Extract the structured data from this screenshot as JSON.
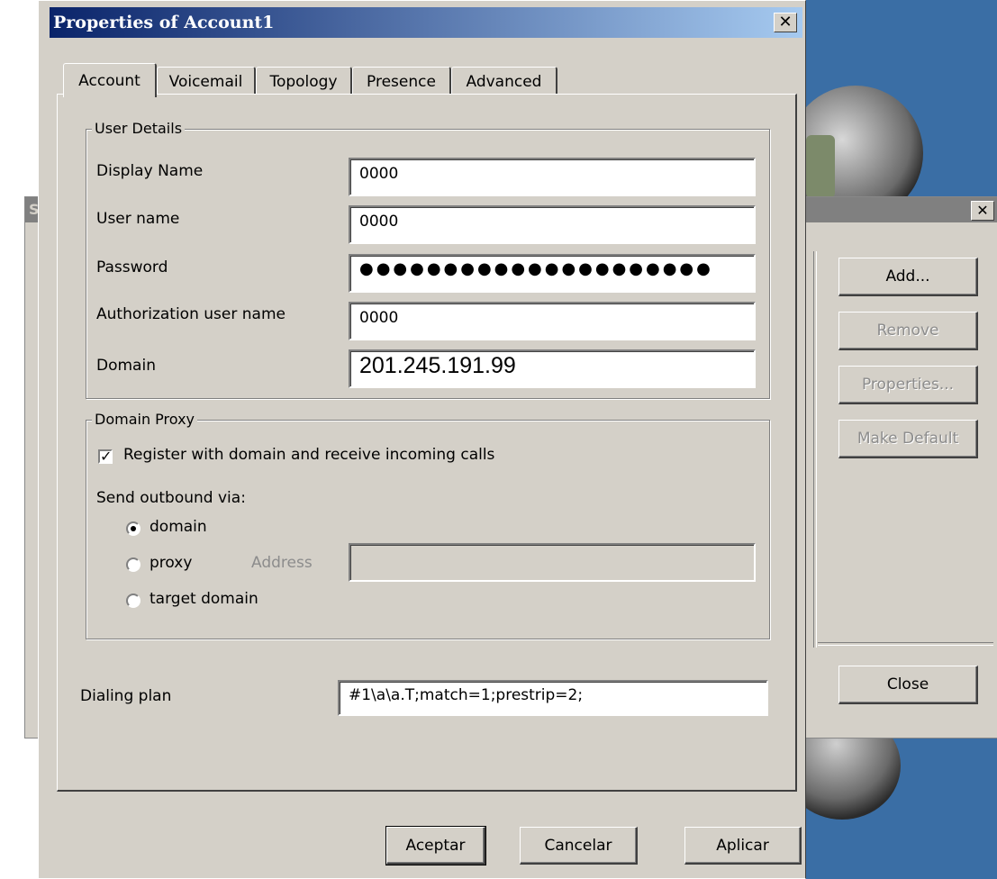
{
  "background_window": {
    "title_fragment": "SI",
    "close_glyph": "✕",
    "buttons": {
      "add": "Add...",
      "remove": "Remove",
      "properties": "Properties...",
      "make_default": "Make Default",
      "close": "Close"
    }
  },
  "dialog": {
    "title": "Properties of Account1",
    "close_glyph": "✕",
    "tabs": [
      "Account",
      "Voicemail",
      "Topology",
      "Presence",
      "Advanced"
    ],
    "user_details": {
      "legend": "User Details",
      "display_name_label": "Display Name",
      "display_name_value": "0000",
      "user_name_label": "User name",
      "user_name_value": "0000",
      "password_label": "Password",
      "password_mask": "●●●●●●●●●●●●●●●●●●●●●",
      "auth_user_label": "Authorization user name",
      "auth_user_value": "0000",
      "domain_label": "Domain",
      "domain_value": "201.245.191.99"
    },
    "domain_proxy": {
      "legend": "Domain Proxy",
      "register_label": "Register with domain and receive incoming calls",
      "register_checked": true,
      "send_outbound_label": "Send outbound via:",
      "option_domain": "domain",
      "option_proxy": "proxy",
      "address_label": "Address",
      "address_value": "",
      "option_target_domain": "target domain",
      "selected": "domain"
    },
    "dialing_plan": {
      "label": "Dialing plan",
      "value": "#1\\a\\a.T;match=1;prestrip=2;"
    },
    "buttons": {
      "ok": "Aceptar",
      "cancel": "Cancelar",
      "apply": "Aplicar"
    }
  }
}
